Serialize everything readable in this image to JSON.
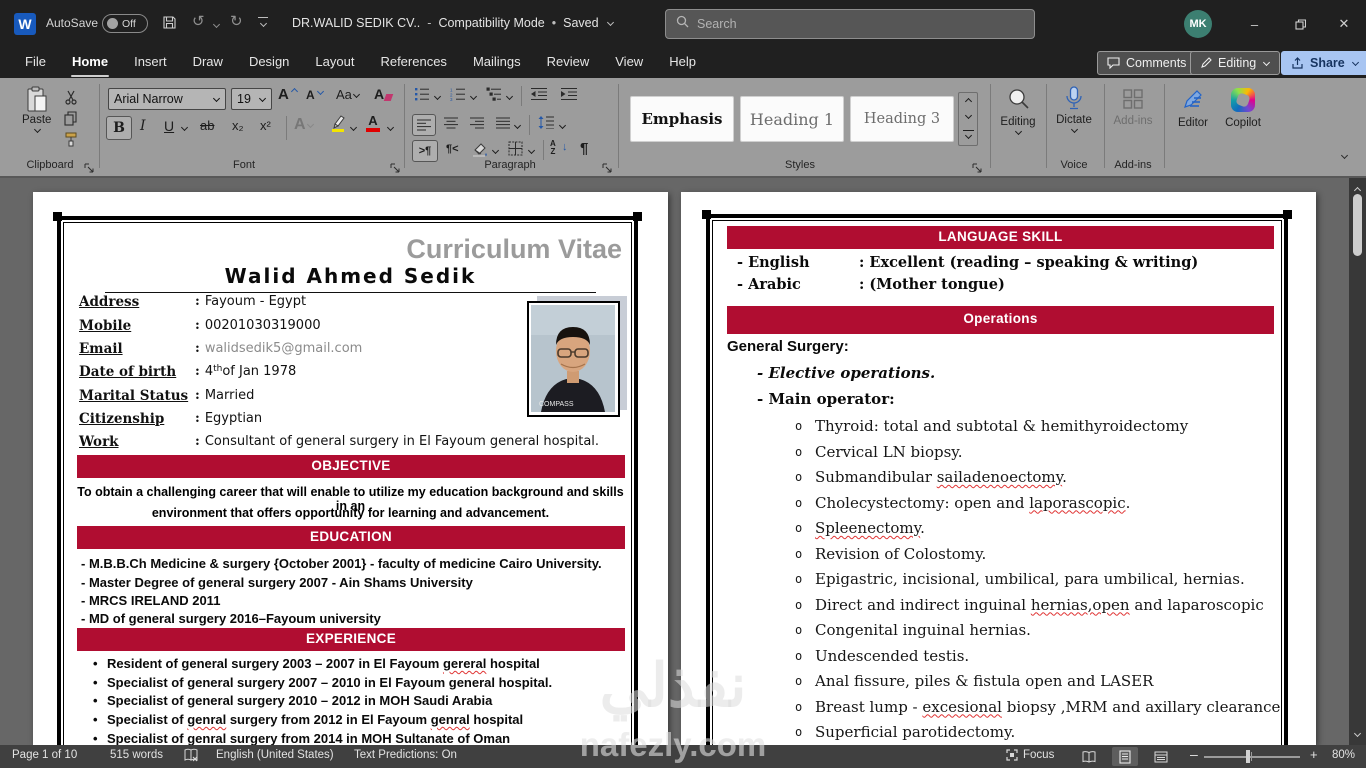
{
  "titlebar": {
    "autosave": "AutoSave",
    "autosave_state": "Off",
    "doc_title": "DR.WALID SEDIK CV..",
    "dash": "-",
    "mode": "Compatibility Mode",
    "dot": "•",
    "saved": "Saved",
    "search_placeholder": "Search",
    "avatar": "MK"
  },
  "menubar": {
    "tabs": [
      "File",
      "Home",
      "Insert",
      "Draw",
      "Design",
      "Layout",
      "References",
      "Mailings",
      "Review",
      "View",
      "Help"
    ],
    "comments": "Comments",
    "editing": "Editing",
    "share": "Share"
  },
  "ribbon": {
    "paste": "Paste",
    "font_name": "Arial Narrow",
    "font_size": "19",
    "glyphs": {
      "bold": "B",
      "italic": "I",
      "underline": "U",
      "strike": "ab",
      "subscript": "x₂",
      "superscript": "x²",
      "case": "Aa",
      "clear": "A",
      "effects": "A",
      "fontcolor": "A",
      "pilcrow": "¶",
      "ltr": ">¶",
      "rtl": "¶<",
      "sortA": "A",
      "sortZ": "Z"
    },
    "style_cards": [
      "Emphasis",
      "Heading 1",
      "Heading 3"
    ],
    "groups": {
      "clipboard": "Clipboard",
      "font": "Font",
      "paragraph": "Paragraph",
      "styles": "Styles",
      "voice": "Voice",
      "addins": "Add-ins"
    },
    "editing_btn": "Editing",
    "dictate": "Dictate",
    "addins_btn": "Add-ins",
    "editor": "Editor",
    "copilot": "Copilot"
  },
  "page1": {
    "header_title": "Curriculum Vitae",
    "name": "Walid Ahmed Sedik",
    "bullet": "•",
    "info": [
      {
        "label": "Address",
        "colon": ":",
        "value": "Fayoum - Egypt"
      },
      {
        "label": "Mobile",
        "colon": ":",
        "value": "00201030319000"
      },
      {
        "label": "Email",
        "colon": ":",
        "value": "walidsedik5@gmail.com"
      },
      {
        "label": "Date of birth",
        "colon": ":",
        "v0": "4",
        "sup": "th",
        "v1": " of Jan 1978"
      },
      {
        "label": "Marital Status",
        "colon": ":",
        "value": "Married"
      },
      {
        "label": "Citizenship",
        "colon": ":",
        "value": "Egyptian"
      },
      {
        "label": "Work",
        "colon": ":",
        "value": "Consultant of general surgery in El Fayoum general hospital."
      }
    ],
    "objective_title": "OBJECTIVE",
    "objective_line1": "To obtain a challenging career that will enable to utilize my education background and skills in an",
    "objective_line2": "environment that offers opportunity for learning and advancement.",
    "education_title": "EDUCATION",
    "education": [
      "- M.B.B.Ch Medicine & surgery {October 2001} - faculty of medicine Cairo University.",
      "- Master Degree of general surgery 2007  - Ain Shams University",
      "- MRCS IRELAND 2011",
      "- MD of general surgery 2016–Fayoum university"
    ],
    "experience_title": "EXPERIENCE",
    "experience": [
      {
        "s0": "Resident of general surgery 2003 – 2007 in El Fayoum ",
        "e1": "gereral",
        "s1": " hospital",
        "e2": "",
        "s2": ""
      },
      {
        "s0": "Specialist of general surgery 2007 – 2010 in El Fayoum general hospital.",
        "e1": "",
        "s1": "",
        "e2": "",
        "s2": ""
      },
      {
        "s0": "Specialist of general surgery 2010 – 2012 in MOH Saudi Arabia",
        "e1": "",
        "s1": "",
        "e2": "",
        "s2": ""
      },
      {
        "s0": "Specialist of ",
        "e1": "genral",
        "s1": " surgery from 2012 in El Fayoum ",
        "e2": "genral",
        "s2": " hospital"
      },
      {
        "s0": "Specialist of ",
        "e1": "genral",
        "s1": " surgery from 2014 in MOH Sultanate of Oman",
        "e2": "",
        "s2": ""
      }
    ]
  },
  "page2": {
    "language_title": "LANGUAGE SKILL",
    "bullet": "o",
    "languages": [
      {
        "name": "- English",
        "value": ": Excellent (reading – speaking & writing)"
      },
      {
        "name": "- Arabic",
        "value": ": (Mother tongue)"
      }
    ],
    "operations_title": "Operations",
    "general_surgery": "General Surgery:",
    "elective": "- Elective operations.",
    "main_operator": "- Main operator:",
    "ops": [
      {
        "s0": "Thyroid: total and subtotal & hemithyroidectomy",
        "e1": "",
        "s1": ""
      },
      {
        "s0": "Cervical LN biopsy.",
        "e1": "",
        "s1": ""
      },
      {
        "s0": "Submandibular ",
        "e1": "sailadenoectomy",
        "s1": "."
      },
      {
        "s0": "Cholecystectomy: open and ",
        "e1": "laporascopic",
        "s1": "."
      },
      {
        "s0": "",
        "e1": "Spleenectomy",
        "s1": "."
      },
      {
        "s0": "Revision of Colostomy.",
        "e1": "",
        "s1": ""
      },
      {
        "s0": "Epigastric, incisional, umbilical, para umbilical, hernias.",
        "e1": "",
        "s1": ""
      },
      {
        "s0": "Direct and indirect inguinal ",
        "e1": "hernias,open",
        "s1": " and laparoscopic"
      },
      {
        "s0": "Congenital inguinal hernias.",
        "e1": "",
        "s1": ""
      },
      {
        "s0": "Undescended testis.",
        "e1": "",
        "s1": ""
      },
      {
        "s0": "Anal fissure, piles & fistula open and LASER",
        "e1": "",
        "s1": ""
      },
      {
        "s0": "Breast lump - ",
        "e1": "excesional",
        "s1": " biopsy ,MRM and axillary clearance",
        "e2": "",
        "s2": ""
      },
      {
        "s0": "Superficial parotidectomy.",
        "e1": "",
        "s1": ""
      }
    ]
  },
  "statusbar": {
    "page": "Page 1 of 10",
    "words": "515 words",
    "language": "English (United States)",
    "predictions": "Text Predictions: On",
    "focus": "Focus",
    "zoom_level": "80%"
  },
  "watermark": {
    "arabic": "نفذلي",
    "domain": "nafezly.com"
  },
  "colors": {
    "accent_red": "#b00d31",
    "share_blue": "#a8c5f2"
  }
}
